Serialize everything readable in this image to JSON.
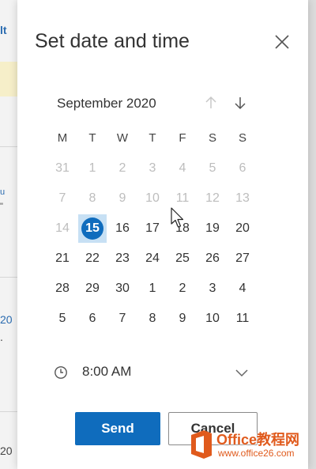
{
  "background": {
    "fragments": [
      "lt",
      "u",
      "\"",
      "20",
      ".",
      "20"
    ]
  },
  "dialog": {
    "title": "Set date and time",
    "close_icon": "close-icon"
  },
  "calendar": {
    "month_label": "September 2020",
    "weekdays": [
      "M",
      "T",
      "W",
      "T",
      "F",
      "S",
      "S"
    ],
    "weeks": [
      [
        {
          "d": "31",
          "m": true
        },
        {
          "d": "1",
          "m": true
        },
        {
          "d": "2",
          "m": true
        },
        {
          "d": "3",
          "m": true
        },
        {
          "d": "4",
          "m": true
        },
        {
          "d": "5",
          "m": true
        },
        {
          "d": "6",
          "m": true
        }
      ],
      [
        {
          "d": "7",
          "m": true
        },
        {
          "d": "8",
          "m": true
        },
        {
          "d": "9",
          "m": true
        },
        {
          "d": "10",
          "m": true
        },
        {
          "d": "11",
          "m": true
        },
        {
          "d": "12",
          "m": true
        },
        {
          "d": "13",
          "m": true
        }
      ],
      [
        {
          "d": "14",
          "m": true
        },
        {
          "d": "15",
          "m": false,
          "selected": true
        },
        {
          "d": "16",
          "m": false
        },
        {
          "d": "17",
          "m": false
        },
        {
          "d": "18",
          "m": false
        },
        {
          "d": "19",
          "m": false
        },
        {
          "d": "20",
          "m": false
        }
      ],
      [
        {
          "d": "21",
          "m": false
        },
        {
          "d": "22",
          "m": false
        },
        {
          "d": "23",
          "m": false
        },
        {
          "d": "24",
          "m": false
        },
        {
          "d": "25",
          "m": false
        },
        {
          "d": "26",
          "m": false
        },
        {
          "d": "27",
          "m": false
        }
      ],
      [
        {
          "d": "28",
          "m": false
        },
        {
          "d": "29",
          "m": false
        },
        {
          "d": "30",
          "m": false
        },
        {
          "d": "1",
          "m": false
        },
        {
          "d": "2",
          "m": false
        },
        {
          "d": "3",
          "m": false
        },
        {
          "d": "4",
          "m": false
        }
      ],
      [
        {
          "d": "5",
          "m": false
        },
        {
          "d": "6",
          "m": false
        },
        {
          "d": "7",
          "m": false
        },
        {
          "d": "8",
          "m": false
        },
        {
          "d": "9",
          "m": false
        },
        {
          "d": "10",
          "m": false
        },
        {
          "d": "11",
          "m": false
        }
      ]
    ]
  },
  "time": {
    "value": "8:00 AM"
  },
  "buttons": {
    "send_label": "Send",
    "cancel_label": "Cancel"
  },
  "watermark": {
    "brand": "Office教程网",
    "url": "www.office26.com"
  },
  "colors": {
    "accent": "#0f6cbd",
    "selected_bg": "#c7e0f4",
    "muted_day": "#bdbdbd",
    "watermark": "#e05a1c"
  }
}
